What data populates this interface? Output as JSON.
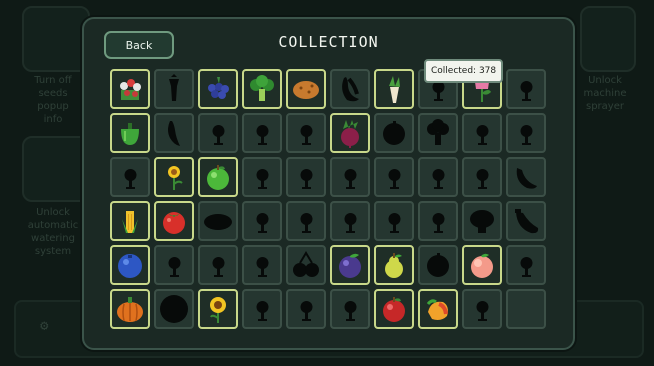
{
  "header": {
    "back_label": "Back",
    "title": "COLLECTION"
  },
  "tooltip": {
    "text": "Collected: 378"
  },
  "background": {
    "left_texts": [
      "Turn off\nseeds\npopup\ninfo",
      "Unlock\nautomatic\nwatering\nsystem"
    ],
    "right_texts": [
      "Unlock\nmachine\nsprayer"
    ]
  },
  "grid": {
    "columns": 10,
    "rows": [
      [
        "flower-bouquet",
        "carrot-silhouette",
        "blueberries",
        "broccoli",
        "potato",
        "banana-silhouette",
        "parsnip",
        "tree-silhouette",
        "tulip",
        "tree-silhouette"
      ],
      [
        "bell-pepper",
        "pepper-silhouette",
        "tree-silhouette",
        "tree-silhouette",
        "tree-silhouette",
        "beetroot",
        "round-silhouette",
        "broccoli-silhouette",
        "tree-silhouette",
        "tree-silhouette"
      ],
      [
        "tree-silhouette",
        "sunflower-sprout",
        "green-apple",
        "tree-silhouette",
        "tree-silhouette",
        "tree-silhouette",
        "tree-silhouette",
        "tree-silhouette",
        "tree-silhouette",
        "cucumber-silhouette"
      ],
      [
        "corn",
        "tomato",
        "potato-silhouette",
        "tree-silhouette",
        "tree-silhouette",
        "tree-silhouette",
        "tree-silhouette",
        "tree-silhouette",
        "mushroom-silhouette",
        "eggplant-silhouette"
      ],
      [
        "blueberry",
        "tree-silhouette",
        "tree-silhouette",
        "tree-silhouette",
        "cherries-silhouette",
        "plum",
        "pear",
        "round-silhouette",
        "peach",
        "tree-silhouette"
      ],
      [
        "pumpkin",
        "melon-silhouette",
        "sunflower",
        "tree-silhouette",
        "tree-silhouette",
        "tree-silhouette",
        "red-apple",
        "mango",
        "tree-silhouette",
        "empty"
      ]
    ]
  },
  "colors": {
    "unlocked_border": "#c8d88a",
    "locked_border": "#3c5047",
    "panel_bg": "#1b2924"
  }
}
